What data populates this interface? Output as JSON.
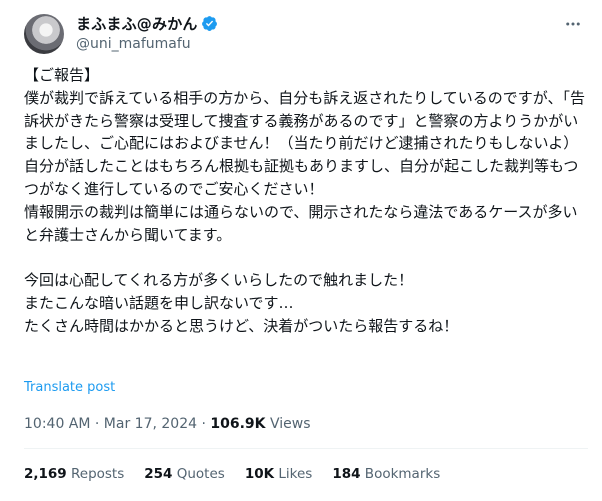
{
  "author": {
    "display_name": "まふまふ@みかん",
    "handle": "@uni_mafumafu"
  },
  "post": {
    "text": "【ご報告】\n僕が裁判で訴えている相手の方から、自分も訴え返されたりしているのですが、「告訴状がきたら警察は受理して捜査する義務があるのです」と警察の方よりうかがいましたし、ご心配にはおよびません！（当たり前だけど逮捕されたりもしないよ）\n自分が話したことはもちろん根拠も証拠もありますし、自分が起こした裁判等もつつがなく進行しているのでご安心ください！\n情報開示の裁判は簡単には通らないので、開示されたなら違法であるケースが多いと弁護士さんから聞いてます。\n\n今回は心配してくれる方が多くいらしたので触れました！\nまたこんな暗い話題を申し訳ないです…\nたくさん時間はかかると思うけど、決着がついたら報告するね！",
    "translate_label": "Translate post",
    "timestamp": "10:40 AM · Mar 17, 2024 · ",
    "views_count": "106.9K",
    "views_label": " Views"
  },
  "stats": {
    "reposts_count": "2,169",
    "reposts_label": " Reposts",
    "quotes_count": "254",
    "quotes_label": " Quotes",
    "likes_count": "10K",
    "likes_label": " Likes",
    "bookmarks_count": "184",
    "bookmarks_label": " Bookmarks"
  },
  "icons": {
    "verified": "verified-badge-icon",
    "more": "more-options-icon"
  },
  "colors": {
    "link": "#1d9bf0",
    "secondary_text": "#536471",
    "primary_text": "#0f1419"
  }
}
